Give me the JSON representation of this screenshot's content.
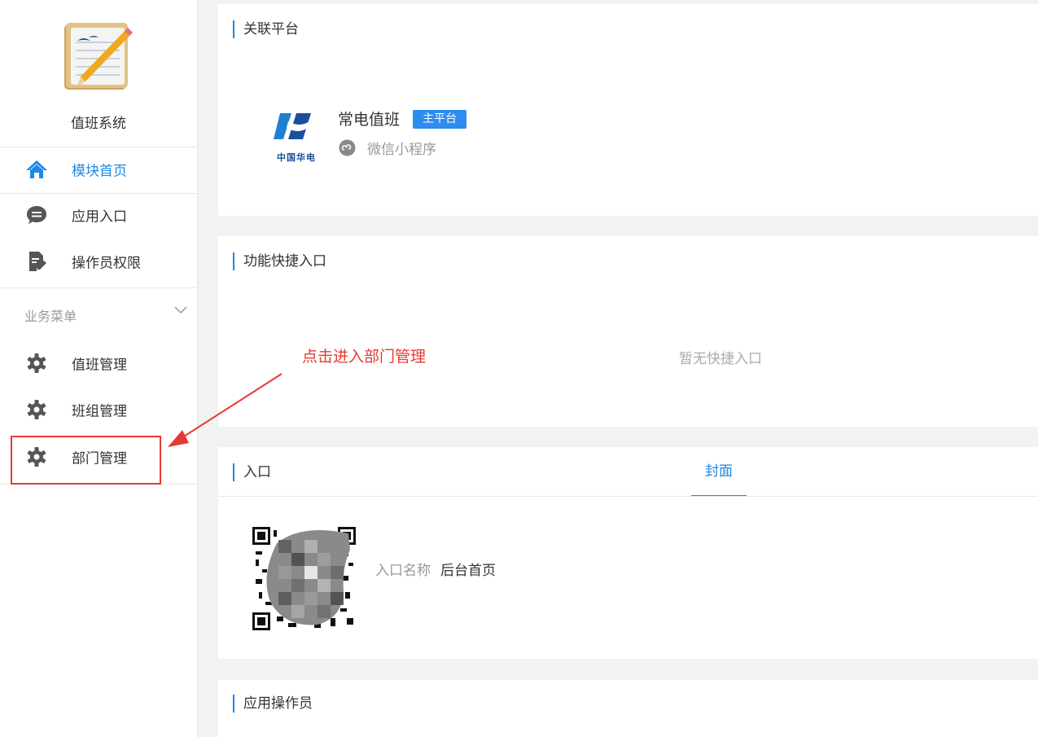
{
  "sidebar": {
    "app_name": "值班系统",
    "items": [
      {
        "label": "模块首页",
        "icon": "home-icon",
        "active": true
      },
      {
        "label": "应用入口",
        "icon": "chat-bubble-icon",
        "active": false
      },
      {
        "label": "操作员权限",
        "icon": "document-edit-icon",
        "active": false
      }
    ],
    "section_title": "业务菜单",
    "menu": [
      {
        "label": "值班管理",
        "icon": "gear-icon"
      },
      {
        "label": "班组管理",
        "icon": "gear-icon"
      },
      {
        "label": "部门管理",
        "icon": "gear-icon"
      }
    ]
  },
  "linked_platform": {
    "title": "关联平台",
    "name": "常电值班",
    "badge": "主平台",
    "type": "微信小程序",
    "logo_text": "中国华电"
  },
  "shortcuts": {
    "title": "功能快捷入口",
    "empty_text": "暂无快捷入口"
  },
  "entry": {
    "title": "入口",
    "tab": "封面",
    "name_label": "入口名称",
    "name_value": "后台首页"
  },
  "operators": {
    "title": "应用操作员"
  },
  "annotation": {
    "text": "点击进入部门管理"
  },
  "colors": {
    "accent": "#1e88e5",
    "annotation": "#e53935",
    "badge": "#2d8cf0"
  }
}
